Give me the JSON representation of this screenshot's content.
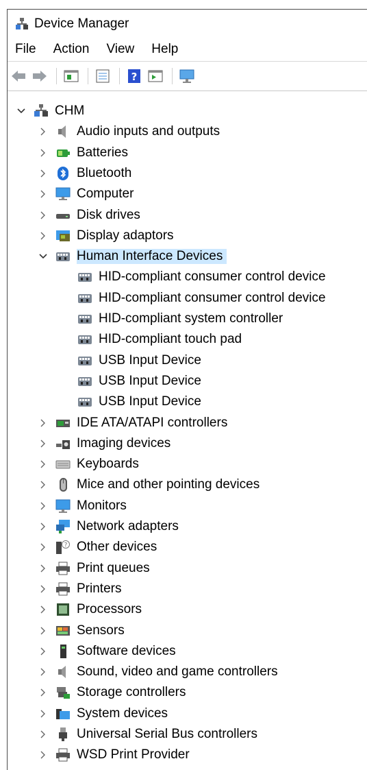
{
  "window": {
    "title": "Device Manager"
  },
  "menu": [
    "File",
    "Action",
    "View",
    "Help"
  ],
  "toolbar_icons": [
    "back-arrow-icon",
    "forward-arrow-icon",
    "properties-icon",
    "list-view-icon",
    "help-icon",
    "run-action-icon",
    "monitor-scan-icon"
  ],
  "tree": {
    "root": {
      "label": "CHM",
      "expanded": true
    },
    "categories": [
      {
        "label": "Audio inputs and outputs",
        "icon": "speaker-icon"
      },
      {
        "label": "Batteries",
        "icon": "battery-icon"
      },
      {
        "label": "Bluetooth",
        "icon": "bluetooth-icon"
      },
      {
        "label": "Computer",
        "icon": "computer-icon"
      },
      {
        "label": "Disk drives",
        "icon": "disk-drive-icon"
      },
      {
        "label": "Display adaptors",
        "icon": "display-adapter-icon"
      },
      {
        "label": "Human Interface Devices",
        "icon": "hid-icon",
        "expanded": true,
        "selected": true,
        "children": [
          "HID-compliant consumer control device",
          "HID-compliant consumer control device",
          "HID-compliant system controller",
          "HID-compliant touch pad",
          "USB Input Device",
          "USB Input Device",
          "USB Input Device"
        ]
      },
      {
        "label": "IDE ATA/ATAPI controllers",
        "icon": "ide-controller-icon"
      },
      {
        "label": "Imaging devices",
        "icon": "camera-icon"
      },
      {
        "label": "Keyboards",
        "icon": "keyboard-icon"
      },
      {
        "label": "Mice and other pointing devices",
        "icon": "mouse-icon"
      },
      {
        "label": "Monitors",
        "icon": "monitor-icon"
      },
      {
        "label": "Network adapters",
        "icon": "network-adapter-icon"
      },
      {
        "label": "Other devices",
        "icon": "other-devices-icon"
      },
      {
        "label": "Print queues",
        "icon": "printer-icon"
      },
      {
        "label": "Printers",
        "icon": "printer-icon"
      },
      {
        "label": "Processors",
        "icon": "processor-icon"
      },
      {
        "label": "Sensors",
        "icon": "sensor-icon"
      },
      {
        "label": "Software devices",
        "icon": "software-device-icon"
      },
      {
        "label": "Sound, video and game controllers",
        "icon": "speaker-icon"
      },
      {
        "label": "Storage controllers",
        "icon": "storage-controller-icon"
      },
      {
        "label": "System devices",
        "icon": "system-devices-icon"
      },
      {
        "label": "Universal Serial Bus controllers",
        "icon": "usb-icon"
      },
      {
        "label": "WSD Print Provider",
        "icon": "printer-icon"
      }
    ]
  },
  "colors": {
    "selection": "#cce8ff",
    "window_border": "#4b4b4b"
  }
}
